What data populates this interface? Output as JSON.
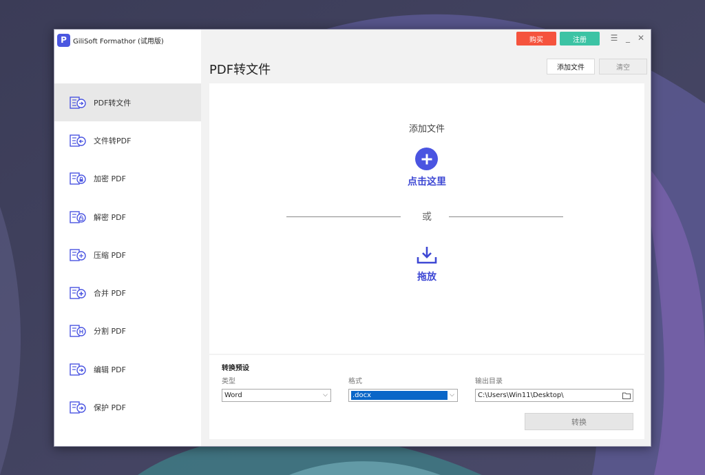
{
  "app": {
    "name": "GiliSoft Formathor (试用版)",
    "logo_letter": "P",
    "buy_label": "购买",
    "register_label": "注册",
    "accent": "#4a54e1",
    "buy_color": "#f5533d",
    "register_color": "#3cc3a4"
  },
  "sidebar": {
    "items": [
      {
        "label": "PDF转文件",
        "icon": "pdf-to-file-icon",
        "active": true
      },
      {
        "label": "文件转PDF",
        "icon": "file-to-pdf-icon",
        "active": false
      },
      {
        "label": "加密 PDF",
        "icon": "encrypt-pdf-icon",
        "active": false
      },
      {
        "label": "解密 PDF",
        "icon": "decrypt-pdf-icon",
        "active": false
      },
      {
        "label": "压缩 PDF",
        "icon": "compress-pdf-icon",
        "active": false
      },
      {
        "label": "合并 PDF",
        "icon": "merge-pdf-icon",
        "active": false
      },
      {
        "label": "分割 PDF",
        "icon": "split-pdf-icon",
        "active": false
      },
      {
        "label": "编辑 PDF",
        "icon": "edit-pdf-icon",
        "active": false
      },
      {
        "label": "保护 PDF",
        "icon": "protect-pdf-icon",
        "active": false
      }
    ]
  },
  "main": {
    "title": "PDF转文件",
    "add_file_label": "添加文件",
    "clear_label": "清空",
    "dropzone": {
      "title": "添加文件",
      "click_here": "点击这里",
      "or": "或",
      "drag": "拖放"
    }
  },
  "settings": {
    "title": "转换预设",
    "type_label": "类型",
    "type_value": "Word",
    "format_label": "格式",
    "format_value": ".docx",
    "output_label": "输出目录",
    "output_value": "C:\\Users\\Win11\\Desktop\\",
    "convert_label": "转换"
  }
}
